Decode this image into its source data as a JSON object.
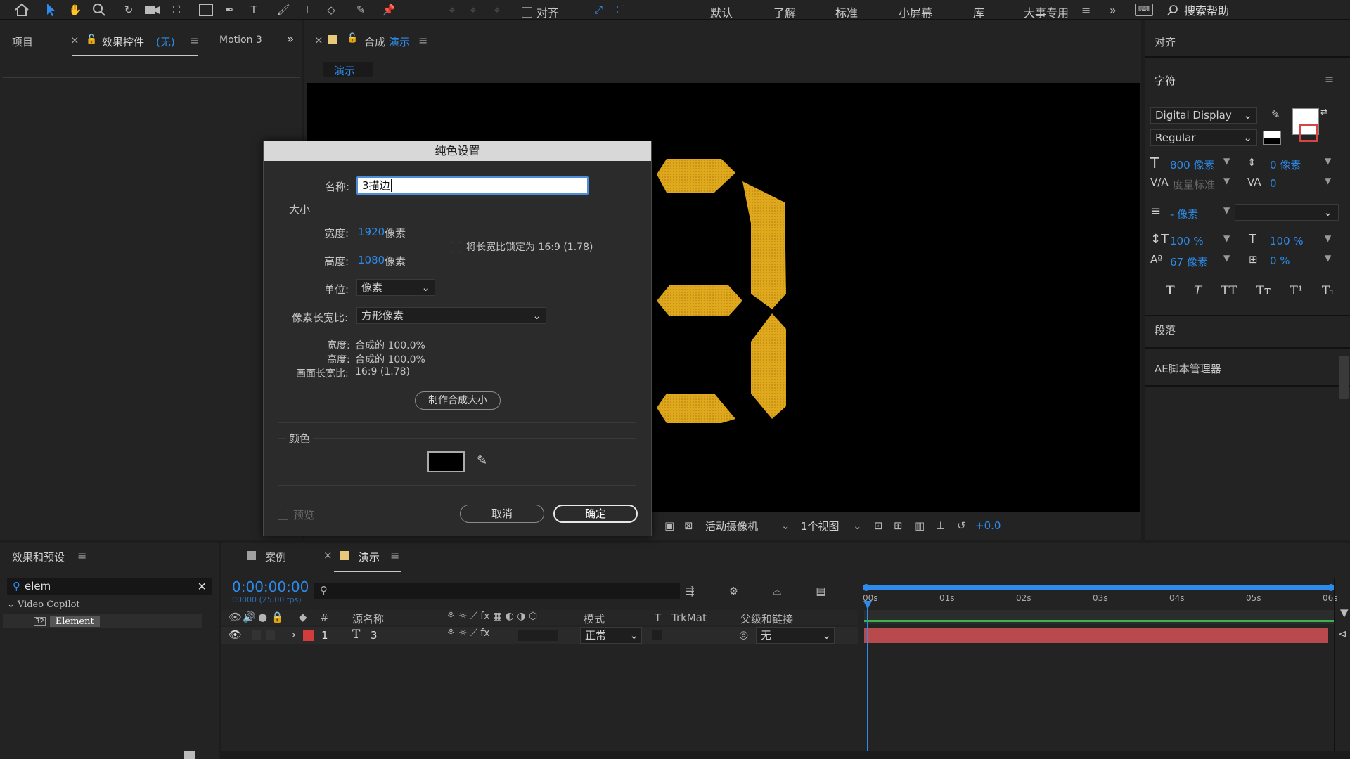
{
  "toolbar": {
    "snap_label": "对齐",
    "workspaces": [
      "默认",
      "了解",
      "标准",
      "小屏幕",
      "库",
      "大事专用"
    ],
    "search_label": "搜索帮助"
  },
  "left_panel": {
    "tab_project": "项目",
    "tab_effects": "效果控件",
    "tab_effects_value": "(无)",
    "tab_motion": "Motion 3"
  },
  "comp_panel": {
    "tab_label": "合成",
    "tab_comp_name": "演示",
    "sub_tab": "演示",
    "footer": {
      "camera": "活动摄像机",
      "views": "1个视图",
      "exposure": "+0.0"
    }
  },
  "dialog": {
    "title": "纯色设置",
    "name_label": "名称:",
    "name_value": "3描边",
    "size_group": "大小",
    "width_label": "宽度:",
    "width_value": "1920",
    "width_unit": "像素",
    "height_label": "高度:",
    "height_value": "1080",
    "height_unit": "像素",
    "lock_label": "将长宽比锁定为 16:9 (1.78)",
    "unit_label": "单位:",
    "unit_value": "像素",
    "par_label": "像素长宽比:",
    "par_value": "方形像素",
    "info_width_label": "宽度:",
    "info_width_value": "合成的 100.0%",
    "info_height_label": "高度:",
    "info_height_value": "合成的 100.0%",
    "info_frame_label": "画面长宽比:",
    "info_frame_value": "16:9 (1.78)",
    "make_comp_size": "制作合成大小",
    "color_group": "颜色",
    "color_value": "#000000",
    "preview_label": "预览",
    "cancel": "取消",
    "ok": "确定"
  },
  "right_panel": {
    "align_title": "对齐",
    "char_title": "字符",
    "font_family": "Digital Display",
    "font_style": "Regular",
    "font_size": "800 像素",
    "leading": "0 像素",
    "kerning": "度量标准",
    "tracking": "0",
    "stroke": "- 像素",
    "vscale": "100 %",
    "hscale": "100 %",
    "baseline": "67 像素",
    "tsume": "0 %",
    "style_buttons": [
      "T",
      "T",
      "TT",
      "Tт",
      "T¹",
      "T₁"
    ],
    "paragraph": "段落",
    "script_manager": "AE脚本管理器"
  },
  "effects_panel": {
    "title": "效果和预设",
    "search_value": "elem",
    "folder": "Video Copilot",
    "item": "Element"
  },
  "timeline": {
    "tab_case": "案例",
    "tab_demo": "演示",
    "timecode": "0:00:00:00",
    "frames": "00000 (25.00 fps)",
    "col_hash": "#",
    "col_source": "源名称",
    "col_mode": "模式",
    "col_t": "T",
    "col_trkmat": "TrkMat",
    "col_parent": "父级和链接",
    "ruler": [
      "00s",
      "01s",
      "02s",
      "03s",
      "04s",
      "05s",
      "06s"
    ],
    "layer": {
      "num": "1",
      "type": "T",
      "name": "3",
      "mode": "正常",
      "parent": "无",
      "color": "#d23c3c"
    }
  },
  "colors": {
    "accent": "#2d8ceb",
    "digit": "#e0a81c",
    "layer_bar": "#b84a4e",
    "work_area": "#3cb44b"
  }
}
